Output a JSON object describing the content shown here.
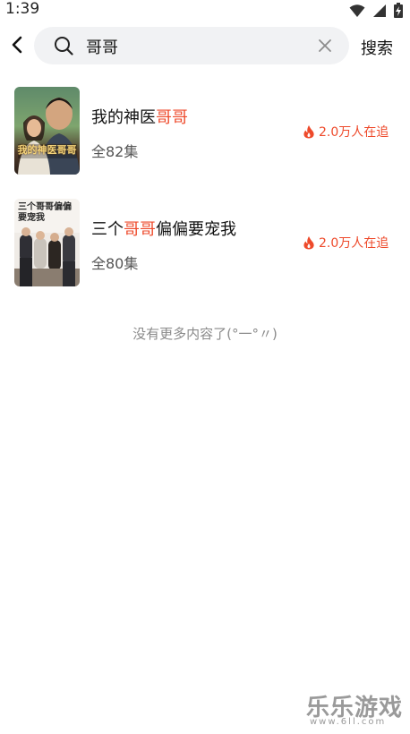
{
  "status": {
    "time": "1:39",
    "icons": [
      "wifi-icon",
      "signal-icon",
      "battery-charging-icon"
    ]
  },
  "search": {
    "query": "哥哥",
    "button_label": "搜索"
  },
  "results": [
    {
      "title_prefix": "我的神医",
      "title_highlight": "哥哥",
      "title_suffix": "",
      "episodes": "全82集",
      "hot": "2.0万人在追",
      "poster_text": "我的神医哥哥"
    },
    {
      "title_prefix": "三个",
      "title_highlight": "哥哥",
      "title_suffix": "偏偏要宠我",
      "episodes": "全80集",
      "hot": "2.0万人在追",
      "poster_text": "三个哥哥偏偏要宠我"
    }
  ],
  "end_message": "没有更多内容了(°一°〃)",
  "watermark": {
    "title": "乐乐游戏",
    "url": "www.6ll.com"
  },
  "colors": {
    "accent": "#ee4a2b",
    "search_bg": "#f1f2f4"
  }
}
